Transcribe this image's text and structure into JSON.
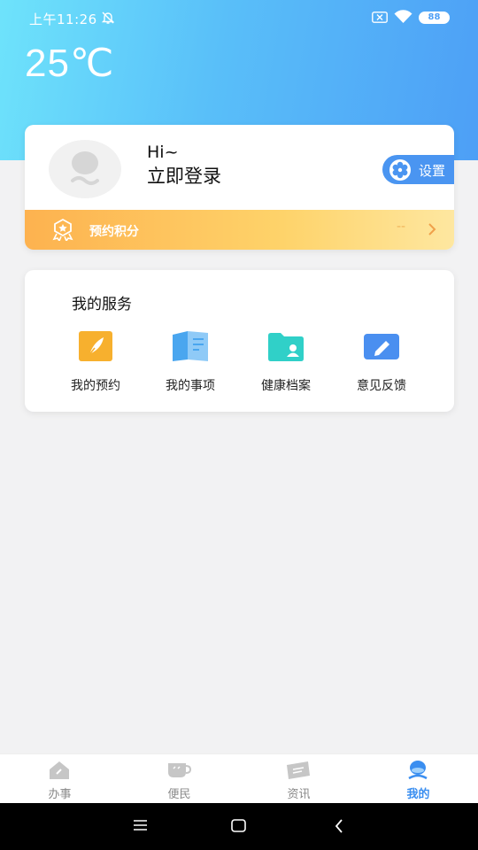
{
  "status_bar": {
    "time": "上午11:26",
    "battery": "88"
  },
  "header": {
    "temperature": "25℃"
  },
  "profile": {
    "greeting": "Hi~",
    "login_label": "立即登录",
    "settings_label": "设置",
    "points_label": "预约积分",
    "points_value": "--"
  },
  "services": {
    "title": "我的服务",
    "items": [
      {
        "label": "我的预约",
        "icon": "feather-note-icon",
        "color": "#f7b02e"
      },
      {
        "label": "我的事项",
        "icon": "open-book-icon",
        "color": "#4aa6ef"
      },
      {
        "label": "健康档案",
        "icon": "folder-user-icon",
        "color": "#30d0c8"
      },
      {
        "label": "意见反馈",
        "icon": "edit-pencil-icon",
        "color": "#4a8ff0"
      }
    ]
  },
  "tabbar": {
    "tabs": [
      {
        "label": "办事",
        "icon": "house-icon",
        "active": false
      },
      {
        "label": "便民",
        "icon": "cup-icon",
        "active": false
      },
      {
        "label": "资讯",
        "icon": "news-icon",
        "active": false
      },
      {
        "label": "我的",
        "icon": "person-icon",
        "active": true
      }
    ]
  },
  "colors": {
    "accent": "#3a8ef0",
    "header_start": "#6ee3fb",
    "header_end": "#4d9ff6",
    "points_start": "#fdb24f"
  }
}
